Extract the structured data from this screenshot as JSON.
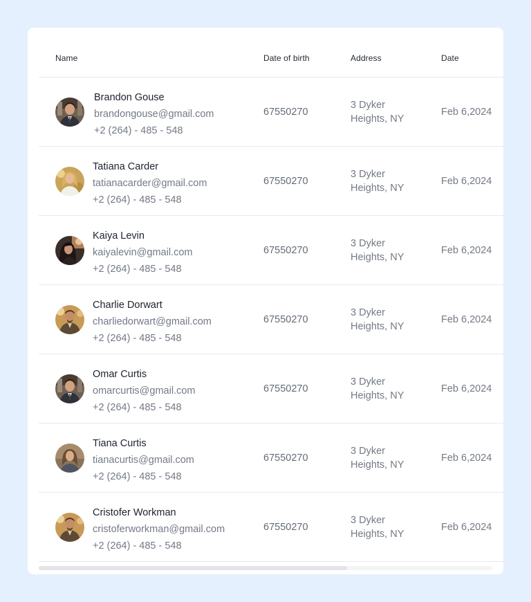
{
  "columns": {
    "name": "Name",
    "dob": "Date of birth",
    "address": "Address",
    "date": "Date"
  },
  "rows": [
    {
      "name": "Brandon Gouse",
      "email": "brandongouse@gmail.com",
      "phone": "+2 (264) - 485 - 548",
      "dob": "67550270",
      "address": "3 Dyker Heights, NY",
      "date": "Feb 6,2024",
      "avatar": "avatar-man-suit"
    },
    {
      "name": "Tatiana Carder",
      "email": "tatianacarder@gmail.com",
      "phone": "+2 (264) - 485 - 548",
      "dob": "67550270",
      "address": "3 Dyker Heights, NY",
      "date": "Feb 6,2024",
      "avatar": "avatar-woman-blonde"
    },
    {
      "name": "Kaiya Levin",
      "email": "kaiyalevin@gmail.com",
      "phone": "+2 (264) - 485 - 548",
      "dob": "67550270",
      "address": "3 Dyker Heights, NY",
      "date": "Feb 6,2024",
      "avatar": "avatar-woman-dark"
    },
    {
      "name": "Charlie Dorwart",
      "email": "charliedorwart@gmail.com",
      "phone": "+2 (264) - 485 - 548",
      "dob": "67550270",
      "address": "3 Dyker Heights, NY",
      "date": "Feb 6,2024",
      "avatar": "avatar-man-jacket"
    },
    {
      "name": "Omar Curtis",
      "email": "omarcurtis@gmail.com",
      "phone": "+2 (264) - 485 - 548",
      "dob": "67550270",
      "address": "3 Dyker Heights, NY",
      "date": "Feb 6,2024",
      "avatar": "avatar-man-suit"
    },
    {
      "name": "Tiana Curtis",
      "email": "tianacurtis@gmail.com",
      "phone": "+2 (264) - 485 - 548",
      "dob": "67550270",
      "address": "3 Dyker Heights, NY",
      "date": "Feb 6,2024",
      "avatar": "avatar-woman-brown"
    },
    {
      "name": "Cristofer Workman",
      "email": "cristoferworkman@gmail.com",
      "phone": "+2 (264) - 485 - 548",
      "dob": "67550270",
      "address": "3 Dyker Heights, NY",
      "date": "Feb 6,2024",
      "avatar": "avatar-man-jacket"
    }
  ],
  "scrollbar": {
    "visible_fraction": 0.68
  }
}
